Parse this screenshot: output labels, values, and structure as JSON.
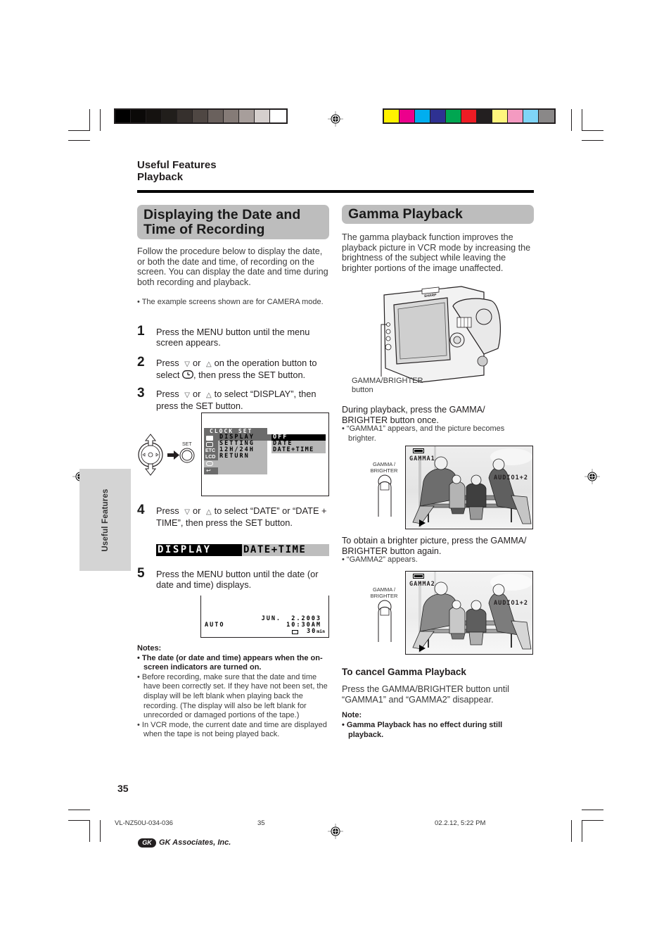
{
  "header": {
    "section": "Useful Features",
    "subsection": "Playback"
  },
  "print_marks": {
    "gray_swatches": [
      "#000000",
      "#0b0908",
      "#151210",
      "#211e1b",
      "#36302d",
      "#4f4743",
      "#6a615d",
      "#857b77",
      "#a79e9b",
      "#d5cfcd",
      "#ffffff"
    ],
    "color_swatches": [
      "#fff200",
      "#ec008c",
      "#00aeef",
      "#2e3192",
      "#00a651",
      "#ed1c24",
      "#231f20",
      "#fff57d",
      "#f49ac1",
      "#7fd5f7",
      "#8a8888"
    ]
  },
  "left": {
    "title": "Displaying the Date and Time of Recording",
    "intro": "Follow the procedure below to display the date, or both the date and time, of recording on the screen. You can display the date and time during both recording and playback.",
    "bullet_note": "• The example screens shown are for CAMERA mode.",
    "steps": [
      {
        "num": "1",
        "text": "Press the MENU button until the menu screen appears."
      },
      {
        "num": "2",
        "text_a": "Press",
        "text_b": "or",
        "text_c": "on the operation button to select",
        "text_d": ", then press the SET button."
      },
      {
        "num": "3",
        "text_a": "Press",
        "text_b": "or",
        "text_c": "to select “DISPLAY”, then press the SET button."
      },
      {
        "num": "4",
        "text_a": "Press",
        "text_b": "or",
        "text_c": "to select “DATE” or “DATE + TIME”, then press the SET button."
      },
      {
        "num": "5",
        "text": "Press the MENU button until the date (or date and time) displays."
      }
    ],
    "set_label": "SET",
    "menu_screen": {
      "header": "CLOCK SET",
      "items": [
        "DISPLAY",
        "SETTING",
        "12H/24H",
        "RETURN"
      ],
      "options": [
        "OFF",
        "DATE",
        "DATE+TIME"
      ],
      "selected_option": "OFF",
      "side_icons": [
        "camera-icon",
        "camera2-icon",
        "ETC",
        "LCD",
        "clock-icon",
        "return-icon"
      ]
    },
    "display_bar": {
      "key": "DISPLAY",
      "value": "DATE+TIME"
    },
    "date_screen": {
      "mode": "AUTO",
      "date": "JUN.  2.2003",
      "time": "10:30AM",
      "tape_remaining": "30",
      "tape_unit": "min"
    },
    "notes_title": "Notes:",
    "notes": [
      {
        "bold": true,
        "text": "The date (or date and time) appears when the on-screen indicators are turned on."
      },
      {
        "bold": false,
        "text": "Before recording, make sure that the date and time have been correctly set. If they have not been set, the display will be left blank when playing back the recording. (The display will also be left blank for unrecorded or damaged portions of the tape.)"
      },
      {
        "bold": false,
        "text": "In VCR mode, the current date and time are displayed when the tape is not being played back."
      }
    ]
  },
  "right": {
    "title": "Gamma Playback",
    "intro": "The gamma playback function improves the playback picture in VCR mode by increasing the brightness of the subject while leaving the brighter portions of the image unaffected.",
    "camera_caption_1": "GAMMA/BRIGHTER",
    "camera_caption_2": "button",
    "brand_badge": "SHARP",
    "step_once": "During playback, press the GAMMA/ BRIGHTER button once.",
    "bullet_gamma1": "• “GAMMA1” appears, and the picture becomes brighter.",
    "button_label_1": "GAMMA /",
    "button_label_2": "BRIGHTER",
    "screen1": {
      "gamma": "GAMMA1",
      "audio": "AUDIO1+2"
    },
    "step_again": "To obtain a brighter picture, press the GAMMA/ BRIGHTER button again.",
    "bullet_gamma2": "• “GAMMA2” appears.",
    "screen2": {
      "gamma": "GAMMA2",
      "audio": "AUDIO1+2"
    },
    "cancel_title": "To cancel Gamma Playback",
    "cancel_text": "Press the GAMMA/BRIGHTER button until “GAMMA1” and “GAMMA2” disappear.",
    "note_title": "Note:",
    "note_text": "• Gamma Playback has no effect during still playback."
  },
  "side_tab": "Useful Features",
  "footer": {
    "page_number": "35",
    "file_id": "VL-NZ50U-034-036",
    "slug_page": "35",
    "timestamp": "02.2.12, 5:22 PM",
    "publisher_logo": "GK",
    "publisher": "GK Associates, Inc."
  }
}
